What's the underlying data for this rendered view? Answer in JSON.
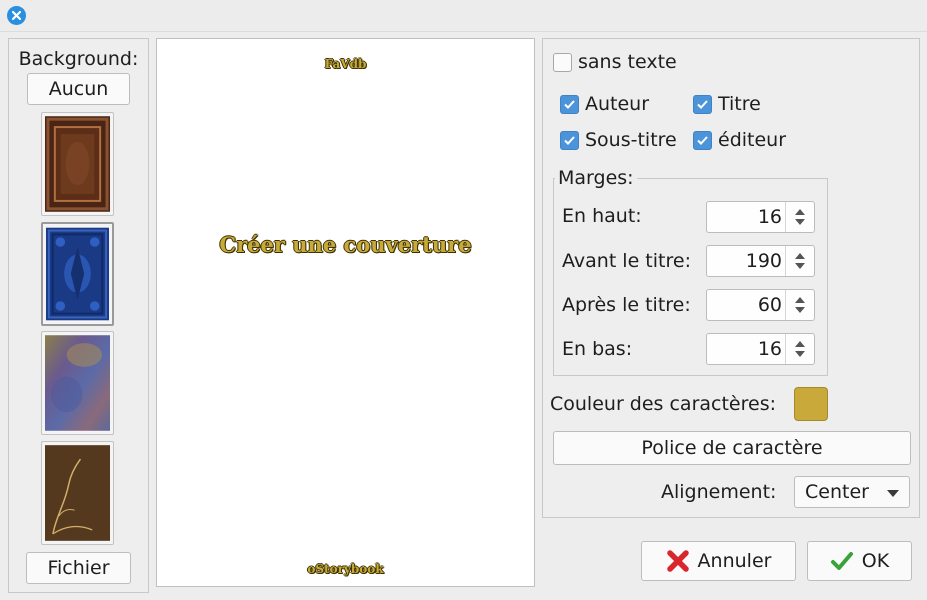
{
  "titlebar": {
    "close_icon": "close-icon"
  },
  "left": {
    "label": "Background:",
    "none_button": "Aucun",
    "file_button": "Fichier",
    "thumbnails": [
      "brown-leather-cover",
      "blue-ornate-cover",
      "iridescent-cover",
      "brown-gold-cover"
    ]
  },
  "preview": {
    "header": "FaVdb",
    "title": "Créer une couverture",
    "footer": "oStorybook",
    "text_color": "#c8a93a"
  },
  "options": {
    "sans_texte": {
      "label": "sans texte",
      "checked": false
    },
    "auteur": {
      "label": "Auteur",
      "checked": true
    },
    "titre": {
      "label": "Titre",
      "checked": true
    },
    "sous_titre": {
      "label": "Sous-titre",
      "checked": true
    },
    "editeur": {
      "label": "éditeur",
      "checked": true
    }
  },
  "margins": {
    "legend": "Marges:",
    "top": {
      "label": "En haut:",
      "value": "16"
    },
    "before_title": {
      "label": "Avant le titre:",
      "value": "190"
    },
    "after_title": {
      "label": "Après le titre:",
      "value": "60"
    },
    "bottom": {
      "label": "En bas:",
      "value": "16"
    }
  },
  "char_color": {
    "label": "Couleur des caractères:",
    "value": "#c9a93a"
  },
  "font_button": "Police de caractère",
  "alignment": {
    "label": "Alignement:",
    "value": "Center"
  },
  "actions": {
    "cancel": "Annuler",
    "ok": "OK"
  }
}
